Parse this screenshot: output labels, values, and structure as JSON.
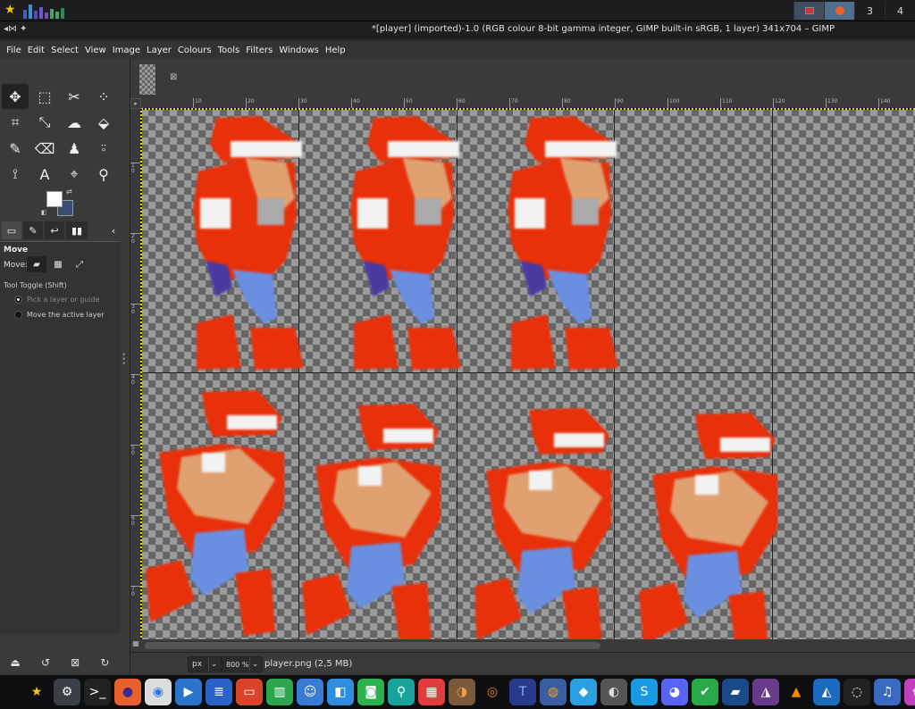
{
  "top_panel": {
    "pager": [
      "3",
      "4"
    ],
    "colors": {
      "panel": "#1d1d1f"
    },
    "cpu_bars": [
      {
        "color": "#4a5fb8",
        "level": 0.55
      },
      {
        "color": "#3f8fd8",
        "level": 0.9
      },
      {
        "color": "#5a4ab8",
        "level": 0.5
      },
      {
        "color": "#6a5acd",
        "level": 0.7
      },
      {
        "color": "#7a4bc0",
        "level": 0.4
      },
      {
        "color": "#4b9e6e",
        "level": 0.6
      },
      {
        "color": "#3aa868",
        "level": 0.45
      },
      {
        "color": "#2e8b57",
        "level": 0.65
      }
    ]
  },
  "window": {
    "title": "*[player] (imported)-1.0 (RGB colour 8-bit gamma integer, GIMP built-in sRGB, 1 layer) 341x704 – GIMP"
  },
  "menubar": [
    "File",
    "Edit",
    "Select",
    "View",
    "Image",
    "Layer",
    "Colours",
    "Tools",
    "Filters",
    "Windows",
    "Help"
  ],
  "toolbox": {
    "tools": [
      {
        "name": "move-tool",
        "glyph": "✥",
        "selected": true
      },
      {
        "name": "rect-select-tool",
        "glyph": "⬚",
        "selected": false
      },
      {
        "name": "scissors-tool",
        "glyph": "✂",
        "selected": false
      },
      {
        "name": "fuzzy-select-tool",
        "glyph": "⁘",
        "selected": false
      },
      {
        "name": "crop-tool",
        "glyph": "⌗",
        "selected": false
      },
      {
        "name": "transform-tool",
        "glyph": "⤡",
        "selected": false
      },
      {
        "name": "warp-tool",
        "glyph": "☁",
        "selected": false
      },
      {
        "name": "bucket-fill-tool",
        "glyph": "⬙",
        "selected": false
      },
      {
        "name": "paintbrush-tool",
        "glyph": "✎",
        "selected": false
      },
      {
        "name": "eraser-tool",
        "glyph": "⌫",
        "selected": false
      },
      {
        "name": "clone-tool",
        "glyph": "♟",
        "selected": false
      },
      {
        "name": "smudge-tool",
        "glyph": "⍤",
        "selected": false
      },
      {
        "name": "paths-tool",
        "glyph": "⟟",
        "selected": false
      },
      {
        "name": "text-tool",
        "glyph": "A",
        "selected": false
      },
      {
        "name": "color-picker-tool",
        "glyph": "⌖",
        "selected": false
      },
      {
        "name": "zoom-tool",
        "glyph": "⚲",
        "selected": false
      }
    ],
    "fg_color": "#ffffff",
    "bg_color": "#3a4b74"
  },
  "tool_options": {
    "title": "Move",
    "move_label": "Move:",
    "toggle_label": "Tool Toggle  (Shift)",
    "option1": "Pick a layer or guide",
    "option2": "Move the active layer"
  },
  "rulers": {
    "horizontal": [
      "10",
      "20",
      "30",
      "40",
      "50",
      "60",
      "70",
      "80",
      "90",
      "100",
      "110",
      "120",
      "130",
      "140"
    ],
    "vertical": [
      "10",
      "20",
      "30",
      "40",
      "50",
      "60",
      "70"
    ]
  },
  "canvas": {
    "grid_color": "#222222",
    "suit_red": "#e8300a",
    "hat_white": "#f2f2f2",
    "skin": "#e0a070",
    "pants_blue": "#6a8fe0"
  },
  "statusbar": {
    "unit": "px",
    "zoom": "800 %",
    "file": "player.png (2,5 MB)"
  },
  "taskbar": {
    "apps": [
      {
        "name": "favorites-star",
        "bg": "#0f0f12",
        "glyph": "★",
        "color": "#f5c518"
      },
      {
        "name": "system-settings",
        "bg": "#3a3f46",
        "glyph": "⚙",
        "color": "#fff"
      },
      {
        "name": "terminal",
        "bg": "#222",
        "glyph": ">_",
        "color": "#fff"
      },
      {
        "name": "firefox",
        "bg": "#e8612c",
        "glyph": "●",
        "color": "#3b2a8e"
      },
      {
        "name": "chrome",
        "bg": "#dcdcdc",
        "glyph": "◉",
        "color": "#2a7ae2"
      },
      {
        "name": "media-player",
        "bg": "#2a74c9",
        "glyph": "▶",
        "color": "#fff"
      },
      {
        "name": "document-writer",
        "bg": "#2a62c7",
        "glyph": "≣",
        "color": "#fff"
      },
      {
        "name": "presentation",
        "bg": "#d9452b",
        "glyph": "▭",
        "color": "#fff"
      },
      {
        "name": "spreadsheet",
        "bg": "#2da44e",
        "glyph": "▥",
        "color": "#fff"
      },
      {
        "name": "file-manager",
        "bg": "#3a7bd5",
        "glyph": "☺",
        "color": "#fff"
      },
      {
        "name": "screenshot",
        "bg": "#2f8ee0",
        "glyph": "◧",
        "color": "#fff"
      },
      {
        "name": "camera",
        "bg": "#2bb24c",
        "glyph": "◙",
        "color": "#fff"
      },
      {
        "name": "search-app",
        "bg": "#1aa39a",
        "glyph": "⚲",
        "color": "#fff"
      },
      {
        "name": "app-grid",
        "bg": "#e23c3c",
        "glyph": "▦",
        "color": "#fff"
      },
      {
        "name": "gimp",
        "bg": "#7a5a3a",
        "glyph": "◑",
        "color": "#f0a040"
      },
      {
        "name": "blender",
        "bg": "#0f0f12",
        "glyph": "◎",
        "color": "#f08a20"
      },
      {
        "name": "tiled",
        "bg": "#2a3a8a",
        "glyph": "T",
        "color": "#88b0ff"
      },
      {
        "name": "fish-app",
        "bg": "#3a5fa0",
        "glyph": "◍",
        "color": "#f0a020"
      },
      {
        "name": "cube-app",
        "bg": "#2aa0e0",
        "glyph": "◆",
        "color": "#fff"
      },
      {
        "name": "globe-app",
        "bg": "#555",
        "glyph": "◐",
        "color": "#ddd"
      },
      {
        "name": "skype",
        "bg": "#1a9ae0",
        "glyph": "S",
        "color": "#fff"
      },
      {
        "name": "discord",
        "bg": "#5865f2",
        "glyph": "◕",
        "color": "#fff"
      },
      {
        "name": "shield-app",
        "bg": "#2aa84a",
        "glyph": "✔",
        "color": "#fff"
      },
      {
        "name": "game-launcher",
        "bg": "#1a4a8a",
        "glyph": "▰",
        "color": "#fff"
      },
      {
        "name": "emulator",
        "bg": "#6a3a8a",
        "glyph": "◮",
        "color": "#fff"
      },
      {
        "name": "vlc",
        "bg": "#0f0f12",
        "glyph": "▲",
        "color": "#f08a00"
      },
      {
        "name": "shark-app",
        "bg": "#1a6ac0",
        "glyph": "◭",
        "color": "#fff"
      },
      {
        "name": "obs",
        "bg": "#222",
        "glyph": "◌",
        "color": "#fff"
      },
      {
        "name": "audio-app",
        "bg": "#3a6ac0",
        "glyph": "♫",
        "color": "#fff"
      },
      {
        "name": "palette-app",
        "bg": "#c040c0",
        "glyph": "✿",
        "color": "#fff"
      },
      {
        "name": "dosbox",
        "bg": "#eee",
        "glyph": "▤",
        "color": "#222"
      }
    ]
  }
}
